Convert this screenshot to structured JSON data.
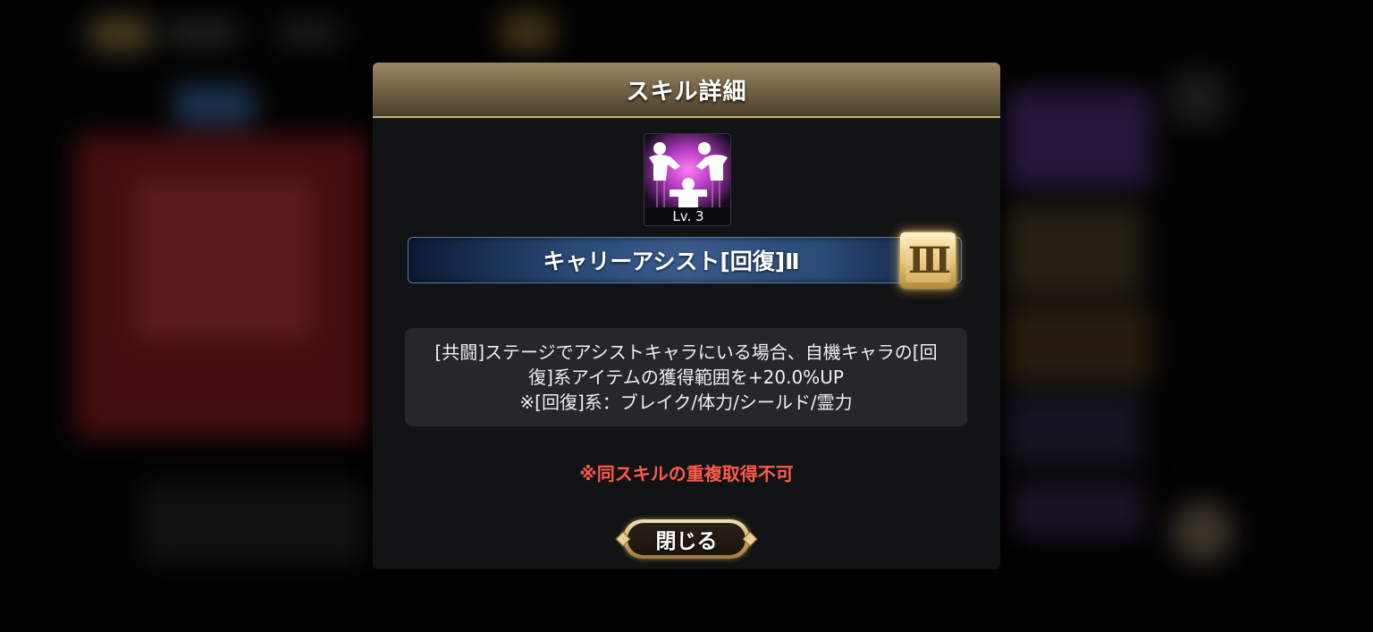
{
  "dialog": {
    "title": "スキル詳細",
    "skill": {
      "icon": "two-figures-assist-icon",
      "level_label": "Lv. 3",
      "name": "キャリーアシスト[回復]Ⅱ",
      "rank_badge": "III"
    },
    "description": [
      "[共闘]ステージでアシストキャラにいる場合、自機キャラの[回",
      "復]系アイテムの獲得範囲を+20.0%UP",
      "※[回復]系：ブレイク/体力/シールド/霊力"
    ],
    "warning": "※同スキルの重複取得不可",
    "close_label": "閉じる"
  },
  "colors": {
    "header_gold": "#9b8763",
    "warning_red": "#ff5a4a",
    "name_bar_blue": "#2a4a78",
    "badge_gold": "#e3bd6a"
  }
}
